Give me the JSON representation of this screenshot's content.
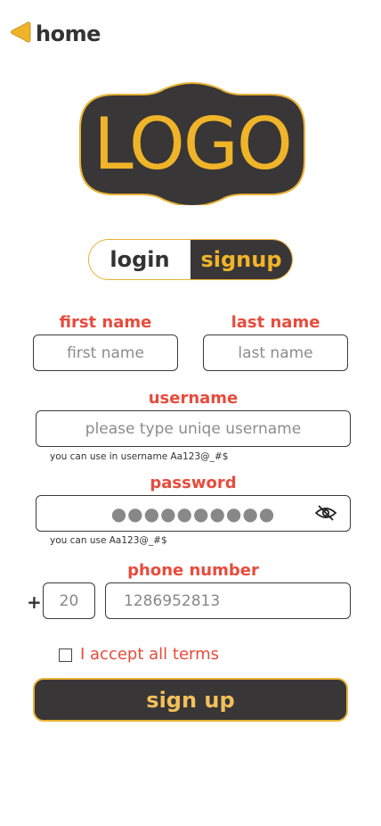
{
  "header": {
    "title": "home",
    "back_icon": "back-arrow-icon"
  },
  "logo": {
    "text": "LOGO"
  },
  "tabs": {
    "login": "login",
    "signup": "signup",
    "active": "signup"
  },
  "form": {
    "first_name": {
      "label": "first name",
      "placeholder": "first name"
    },
    "last_name": {
      "label": "last name",
      "placeholder": "last name"
    },
    "username": {
      "label": "username",
      "placeholder": "please type uniqe username",
      "hint": "you can use in username Aa123@_#$"
    },
    "password": {
      "label": "password",
      "masked_value": "●●●●●●●●●●",
      "hint": "you can use Aa123@_#$",
      "toggle_icon": "eye-slash-icon"
    },
    "phone": {
      "label": "phone number",
      "prefix_symbol": "+",
      "country_code": "20",
      "number": "1286952813"
    },
    "terms_label": "I accept all terms",
    "terms_checked": false,
    "submit_label": "sign up"
  },
  "colors": {
    "accent": "#f0b429",
    "dark": "#393637",
    "label_red": "#e74c3c"
  }
}
